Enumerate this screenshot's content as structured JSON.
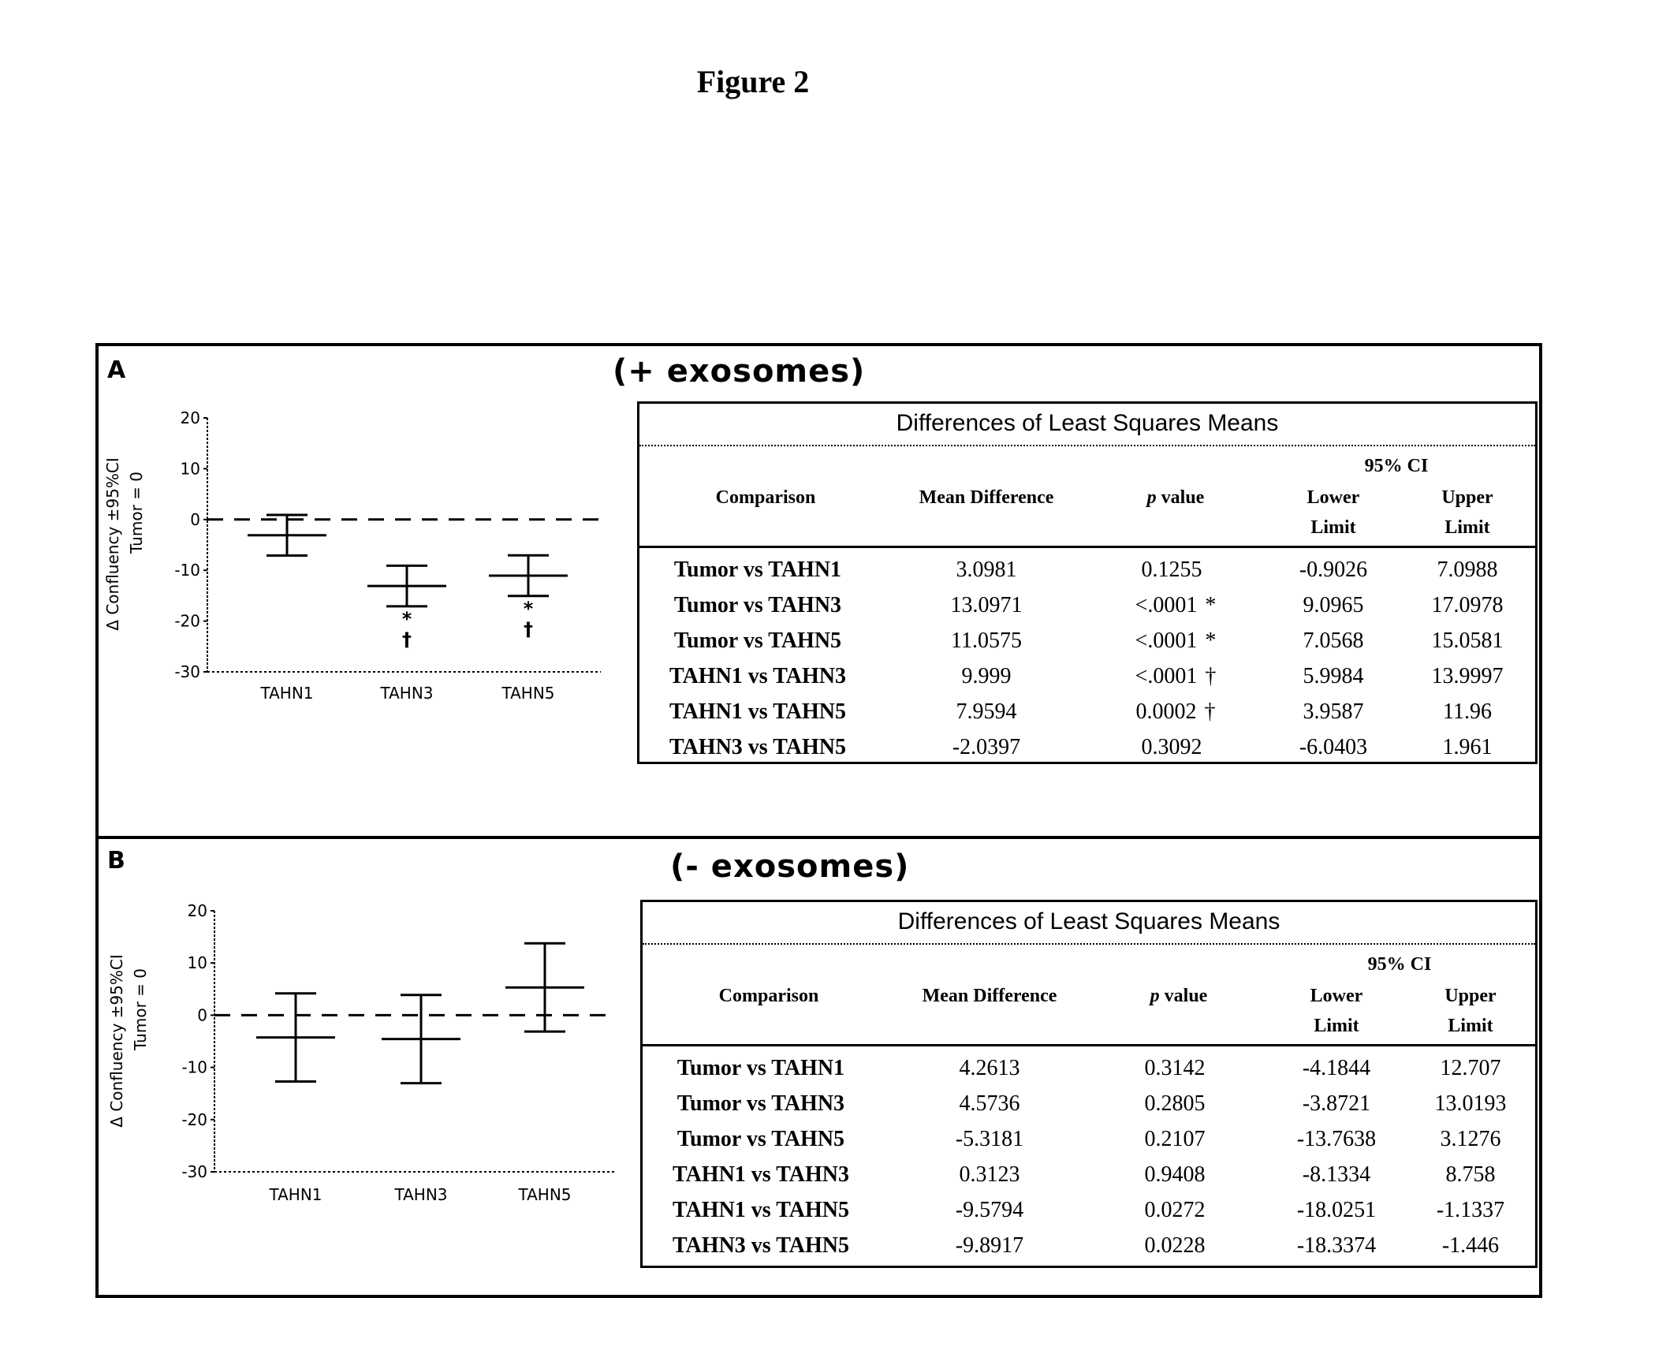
{
  "figure_title": "Figure 2",
  "panels": [
    {
      "letter": "A",
      "heading": "(+ exosomes)",
      "table": {
        "title": "Differences of Least Squares Means",
        "ci_header": "95% CI",
        "columns": [
          "Comparison",
          "Mean Difference",
          "p value",
          "Lower Limit",
          "Upper Limit"
        ],
        "col_labels": {
          "comparison": "Comparison",
          "mean_difference": "Mean Difference",
          "p_prefix": "p",
          "p_suffix": " value",
          "lower_1": "Lower",
          "lower_2": "Limit",
          "upper_1": "Upper",
          "upper_2": "Limit"
        },
        "rows": [
          {
            "comparison": "Tumor vs TAHN1",
            "mean_difference": "3.0981",
            "p_value": "0.1255",
            "mark": "",
            "lower": "-0.9026",
            "upper": "7.0988"
          },
          {
            "comparison": "Tumor vs TAHN3",
            "mean_difference": "13.0971",
            "p_value": "<.0001",
            "mark": "*",
            "lower": "9.0965",
            "upper": "17.0978"
          },
          {
            "comparison": "Tumor vs TAHN5",
            "mean_difference": "11.0575",
            "p_value": "<.0001",
            "mark": "*",
            "lower": "7.0568",
            "upper": "15.0581"
          },
          {
            "comparison": "TAHN1 vs TAHN3",
            "mean_difference": "9.999",
            "p_value": "<.0001",
            "mark": "†",
            "lower": "5.9984",
            "upper": "13.9997"
          },
          {
            "comparison": "TAHN1 vs TAHN5",
            "mean_difference": "7.9594",
            "p_value": "0.0002",
            "mark": "†",
            "lower": "3.9587",
            "upper": "11.96"
          },
          {
            "comparison": "TAHN3 vs TAHN5",
            "mean_difference": "-2.0397",
            "p_value": "0.3092",
            "mark": "",
            "lower": "-6.0403",
            "upper": "1.961"
          }
        ]
      }
    },
    {
      "letter": "B",
      "heading": "(- exosomes)",
      "table": {
        "title": "Differences of Least Squares Means",
        "ci_header": "95% CI",
        "columns": [
          "Comparison",
          "Mean Difference",
          "p value",
          "Lower Limit",
          "Upper Limit"
        ],
        "col_labels": {
          "comparison": "Comparison",
          "mean_difference": "Mean Difference",
          "p_prefix": "p",
          "p_suffix": " value",
          "lower_1": "Lower",
          "lower_2": "Limit",
          "upper_1": "Upper",
          "upper_2": "Limit"
        },
        "rows": [
          {
            "comparison": "Tumor vs TAHN1",
            "mean_difference": "4.2613",
            "p_value": "0.3142",
            "mark": "",
            "lower": "-4.1844",
            "upper": "12.707"
          },
          {
            "comparison": "Tumor vs TAHN3",
            "mean_difference": "4.5736",
            "p_value": "0.2805",
            "mark": "",
            "lower": "-3.8721",
            "upper": "13.0193"
          },
          {
            "comparison": "Tumor vs TAHN5",
            "mean_difference": "-5.3181",
            "p_value": "0.2107",
            "mark": "",
            "lower": "-13.7638",
            "upper": "3.1276"
          },
          {
            "comparison": "TAHN1 vs TAHN3",
            "mean_difference": "0.3123",
            "p_value": "0.9408",
            "mark": "",
            "lower": "-8.1334",
            "upper": "8.758"
          },
          {
            "comparison": "TAHN1 vs TAHN5",
            "mean_difference": "-9.5794",
            "p_value": "0.0272",
            "mark": "",
            "lower": "-18.0251",
            "upper": "-1.1337"
          },
          {
            "comparison": "TAHN3 vs TAHN5",
            "mean_difference": "-9.8917",
            "p_value": "0.0228",
            "mark": "",
            "lower": "-18.3374",
            "upper": "-1.446"
          }
        ]
      }
    }
  ],
  "chart_data": [
    {
      "type": "errorbar",
      "panel": "A",
      "title": "(+ exosomes)",
      "ylabel": "Δ Confluency ±95%CI",
      "ylabel2": "Tumor = 0",
      "xlabel": "",
      "categories": [
        "TAHN1",
        "TAHN3",
        "TAHN5"
      ],
      "means": [
        -3.0981,
        -13.0971,
        -11.0575
      ],
      "lower": [
        -7.0988,
        -17.0978,
        -15.0581
      ],
      "upper": [
        0.9026,
        -9.0965,
        -7.0568
      ],
      "annotations": [
        [],
        [
          "*",
          "†"
        ],
        [
          "*",
          "†"
        ]
      ],
      "reference_line": 0,
      "ylim": [
        -30,
        20
      ],
      "yticks": [
        20,
        10,
        0,
        -10,
        -20,
        -30
      ],
      "grid": false
    },
    {
      "type": "errorbar",
      "panel": "B",
      "title": "(- exosomes)",
      "ylabel": "Δ Confluency ±95%CI",
      "ylabel2": "Tumor = 0",
      "xlabel": "",
      "categories": [
        "TAHN1",
        "TAHN3",
        "TAHN5"
      ],
      "means": [
        -4.2613,
        -4.5736,
        5.3181
      ],
      "lower": [
        -12.707,
        -13.0193,
        -3.1276
      ],
      "upper": [
        4.1844,
        3.8721,
        13.7638
      ],
      "annotations": [
        [],
        [],
        []
      ],
      "reference_line": 0,
      "ylim": [
        -30,
        20
      ],
      "yticks": [
        20,
        10,
        0,
        -10,
        -20,
        -30
      ],
      "grid": false
    }
  ]
}
